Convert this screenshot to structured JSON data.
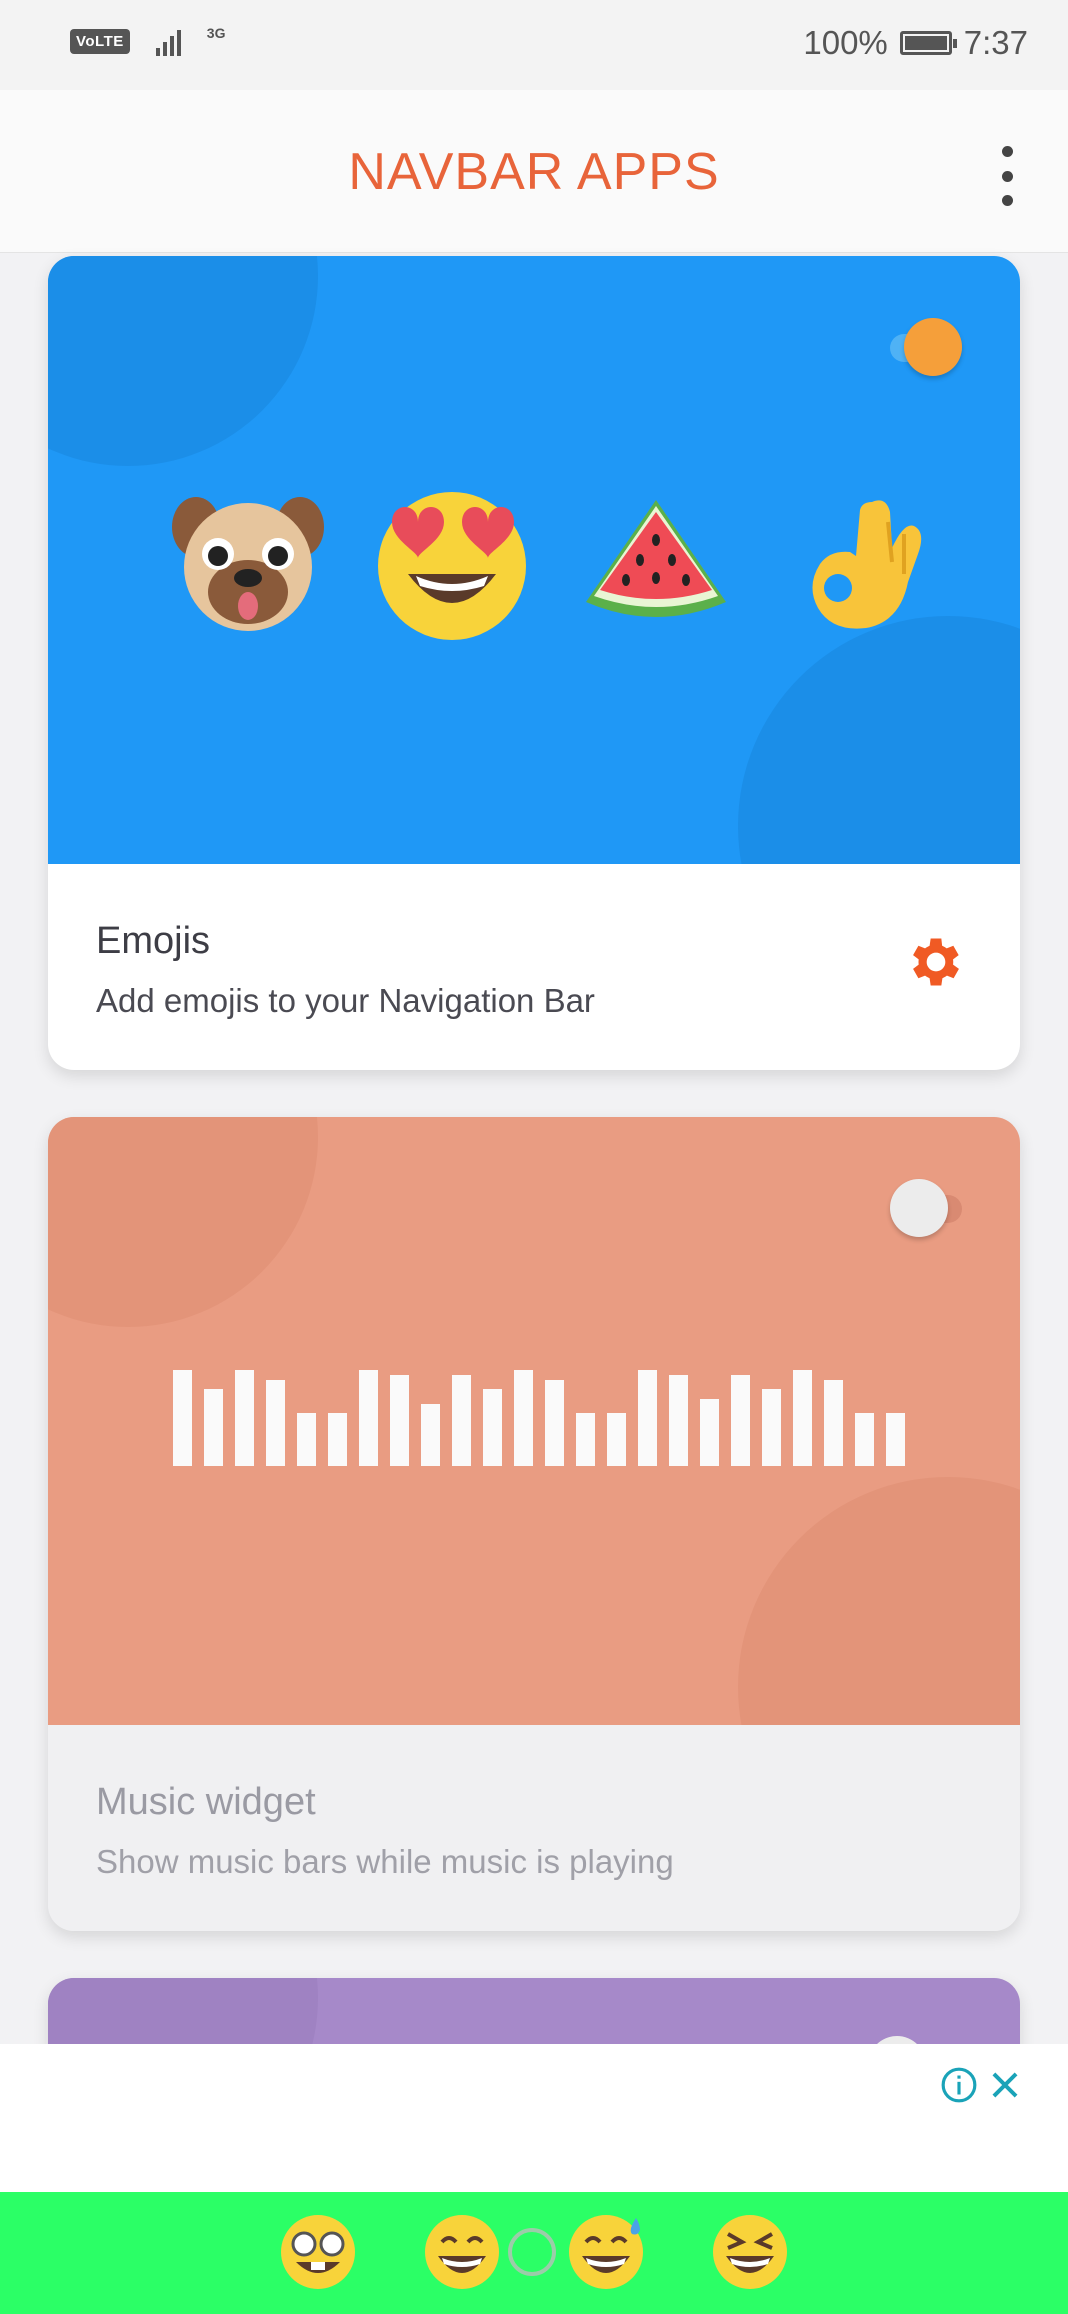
{
  "status_bar": {
    "volte": "VoLTE",
    "network": "3G",
    "battery": "100%",
    "time": "7:37"
  },
  "app_bar": {
    "title": "NAVBAR APPS",
    "menu_icon": "more-vert-icon"
  },
  "cards": [
    {
      "title": "Emojis",
      "subtitle": "Add emojis to your Navigation Bar",
      "enabled": true,
      "hero_color": "#1f98f6",
      "settings_icon": "gear-icon",
      "emojis": [
        "pug-face",
        "heart-eyes-face",
        "watermelon-slice",
        "ok-hand"
      ]
    },
    {
      "title": "Music widget",
      "subtitle": "Show music bars while music is playing",
      "enabled": false,
      "hero_color": "#e99c82",
      "bar_levels": [
        1.0,
        0.8,
        1.0,
        0.9,
        0.55,
        0.55,
        1.0,
        0.95,
        0.65,
        0.95,
        0.8,
        1.0,
        0.9,
        0.55,
        0.55,
        1.0,
        0.95,
        0.7,
        0.95,
        0.8,
        1.0,
        0.9,
        0.55,
        0.55
      ]
    },
    {
      "title": "",
      "subtitle": "",
      "enabled": true,
      "hero_color": "#a689c9"
    }
  ],
  "ad": {
    "info_icon": "info-icon",
    "close_icon": "close-icon"
  },
  "nav_strip": {
    "color": "#2bff66",
    "items": [
      "nerd-glasses-emoji",
      "grinning-emoji",
      "home-circle-button",
      "sweat-smile-emoji",
      "squinting-laugh-emoji"
    ]
  },
  "colors": {
    "accent": "#e8643a",
    "toggle_on": "#f59f3a"
  }
}
